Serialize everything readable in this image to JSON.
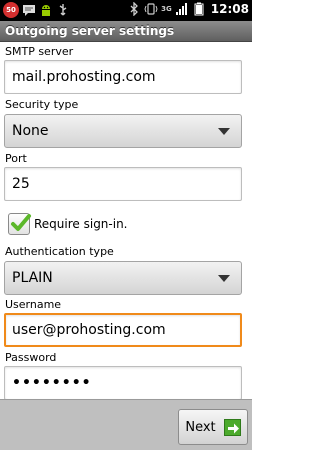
{
  "status_bar": {
    "notification_count": "50",
    "time": "12:08",
    "network_label": "3G",
    "icons": [
      "notification-badge-icon",
      "message-icon",
      "android-icon",
      "usb-icon",
      "bluetooth-icon",
      "vibrate-icon",
      "signal-icon",
      "battery-icon"
    ]
  },
  "title": "Outgoing server settings",
  "fields": {
    "smtp_server": {
      "label": "SMTP server",
      "value": "mail.prohosting.com"
    },
    "security_type": {
      "label": "Security type",
      "value": "None"
    },
    "port": {
      "label": "Port",
      "value": "25"
    },
    "require_signin": {
      "label": "Require sign-in.",
      "checked": true
    },
    "auth_type": {
      "label": "Authentication type",
      "value": "PLAIN"
    },
    "username": {
      "label": "Username",
      "value": "user@prohosting.com"
    },
    "password": {
      "label": "Password",
      "value": "••••••••"
    }
  },
  "buttons": {
    "next": "Next"
  },
  "colors": {
    "focus": "#f08a1a",
    "check": "#5cb82a",
    "next_icon": "#4caa2c"
  }
}
